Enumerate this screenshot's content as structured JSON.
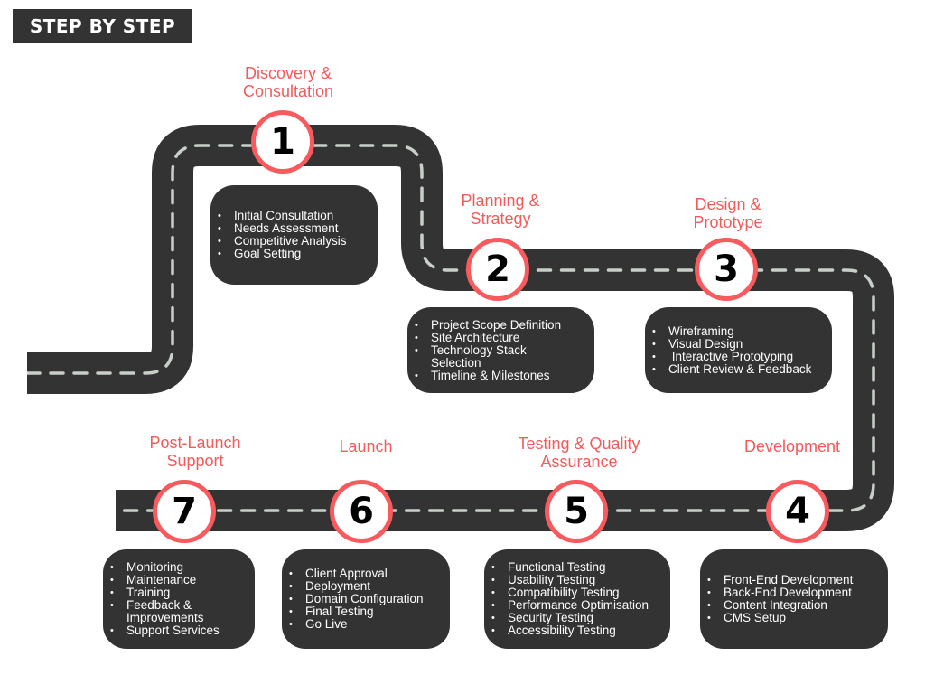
{
  "header": {
    "title": "STEP BY STEP"
  },
  "colors": {
    "road": "#333333",
    "lane": "#c8cfc8",
    "accent": "#f25b5b",
    "marker_border": "#f85a5e",
    "card": "#333333"
  },
  "steps": [
    {
      "number": "1",
      "title_line1": "Discovery &",
      "title_line2": "Consultation",
      "items": [
        "Initial Consultation",
        "Needs Assessment",
        "Competitive Analysis",
        "Goal Setting"
      ]
    },
    {
      "number": "2",
      "title_line1": "Planning &",
      "title_line2": "Strategy",
      "items": [
        "Project Scope Definition",
        "Site Architecture",
        "Technology Stack Selection",
        "Timeline & Milestones"
      ]
    },
    {
      "number": "3",
      "title_line1": "Design &",
      "title_line2": "Prototype",
      "items": [
        "Wireframing",
        "Visual Design",
        " Interactive Prototyping",
        "Client Review & Feedback"
      ]
    },
    {
      "number": "4",
      "title_line1": "Development",
      "title_line2": "",
      "items": [
        "Front-End Development",
        "Back-End Development",
        "Content Integration",
        "CMS Setup"
      ]
    },
    {
      "number": "5",
      "title_line1": "Testing & Quality",
      "title_line2": "Assurance",
      "items": [
        "Functional Testing",
        "Usability Testing",
        "Compatibility Testing",
        "Performance Optimisation",
        "Security Testing",
        "Accessibility Testing"
      ]
    },
    {
      "number": "6",
      "title_line1": "Launch",
      "title_line2": "",
      "items": [
        "Client Approval",
        "Deployment",
        "Domain Configuration",
        "Final Testing",
        "Go Live"
      ]
    },
    {
      "number": "7",
      "title_line1": "Post-Launch",
      "title_line2": "Support",
      "items": [
        "Monitoring",
        "Maintenance",
        "Training",
        "Feedback & Improvements",
        "Support Services"
      ]
    }
  ]
}
